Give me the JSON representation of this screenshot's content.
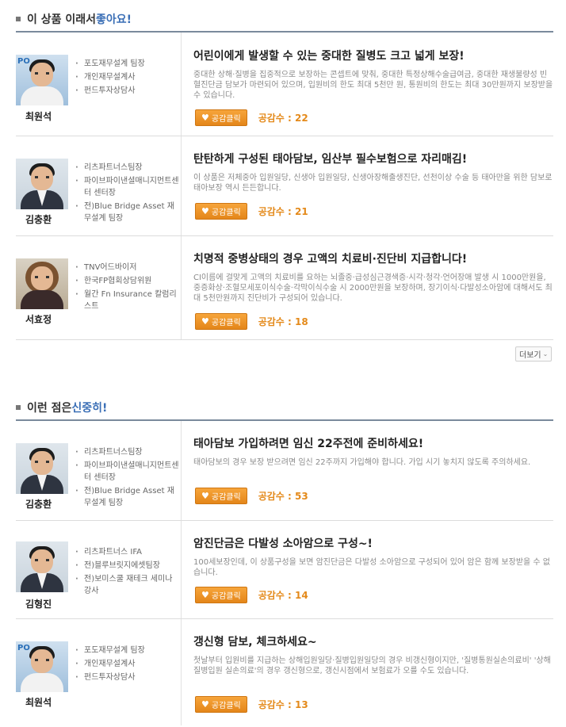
{
  "section1": {
    "title_prefix": "이 상품 이래서 ",
    "title_accent": "좋아요!",
    "cards": [
      {
        "name": "최원석",
        "credentials": [
          "포도재무설계 팀장",
          "개인재무설계사",
          "펀드투자상담사"
        ],
        "headline": "어린이에게 발생할 수 있는 중대한 질병도 크고 넓게 보장!",
        "description": "중대한 상해·질병을 집중적으로 보장하는 콘셉트에 맞춰, 중대한 특정상해수술급여금, 중대한 재생불량성 빈혈진단금 담보가 마련되어 있으며, 입원비의 한도 최대 5천만 원, 통원비의 한도는 최대 30만원까지 보장받을 수 있습니다.",
        "like_label": "공감클릭",
        "like_count_label": "공감수 :",
        "like_count": "22"
      },
      {
        "name": "김충환",
        "credentials": [
          "리츠파트너스팀장",
          "파이브파이낸셜매니지먼트센터 센터장",
          "전)Blue Bridge Asset 재무설계 팀장"
        ],
        "headline": "탄탄하게 구성된 태아담보, 임산부 필수보험으로 자리매김!",
        "description": "이 상품은 저체중아 입원일당, 신생아 입원일당, 신생아장해출생진단, 선천이상 수술 등 태아만을 위한 담보로 태아보장 역시 든든합니다.",
        "like_label": "공감클릭",
        "like_count_label": "공감수 :",
        "like_count": "21"
      },
      {
        "name": "서효정",
        "credentials": [
          "TNV어드바이저",
          "한국FP협회상담위원",
          "월간 Fn Insurance 칼럼리스트"
        ],
        "headline": "치명적 중병상태의 경우 고액의 치료비·진단비 지급합니다!",
        "description": "CI이름에 걸맞게 고액의 치료비를 요하는 뇌졸중·급성심근경색증·시각·청각·언어장애 발생 시 1000만원을, 중증화상·조혈모세포이식수술·각막이식수술 시 2000만원을 보장하며, 장기이식·다발성소아암에 대해서도 최대 5천만원까지 진단비가 구성되어 있습니다.",
        "like_label": "공감클릭",
        "like_count_label": "공감수 :",
        "like_count": "18"
      }
    ]
  },
  "more_label": "더보기",
  "section2": {
    "title_prefix": "이런 점은 ",
    "title_accent": "신중히!",
    "cards": [
      {
        "name": "김충환",
        "credentials": [
          "리츠파트너스팀장",
          "파이브파이낸셜매니지먼트센터 센터장",
          "전)Blue Bridge Asset 재무설계 팀장"
        ],
        "headline": "태아담보 가입하려면 임신 22주전에 준비하세요!",
        "description": "태아담보의 경우 보장 받으려면 임신 22주까지 가입해야 합니다. 가입 시기 놓치지 않도록 주의하세요.",
        "like_label": "공감클릭",
        "like_count_label": "공감수 :",
        "like_count": "53"
      },
      {
        "name": "김형진",
        "credentials": [
          "리츠파트너스 IFA",
          "전)블루브릿지에셋팀장",
          "전)보미스쿨 재테크 세미나 강사"
        ],
        "headline": "암진단금은 다발성 소아암으로 구성~!",
        "description": "100세보장인데, 이 상품구성을 보면 암진단금은 다발성 소아암으로 구성되어 있어 암은 함께 보장받을 수 없습니다.",
        "like_label": "공감클릭",
        "like_count_label": "공감수 :",
        "like_count": "14"
      },
      {
        "name": "최원석",
        "credentials": [
          "포도재무설계 팀장",
          "개인재무설계사",
          "펀드투자상담사"
        ],
        "headline": "갱신형 담보, 체크하세요~",
        "description": "첫날부터 입원비를 지급하는 상해입원일당·질병입원일당의 경우 비갱신형이지만, '질병통원실손의료비' '상해질병입원 실손의료'의 경우 갱신형으로, 갱신시점에서 보험료가 오를 수도 있습니다.",
        "like_label": "공감클릭",
        "like_count_label": "공감수 :",
        "like_count": "13"
      }
    ]
  }
}
